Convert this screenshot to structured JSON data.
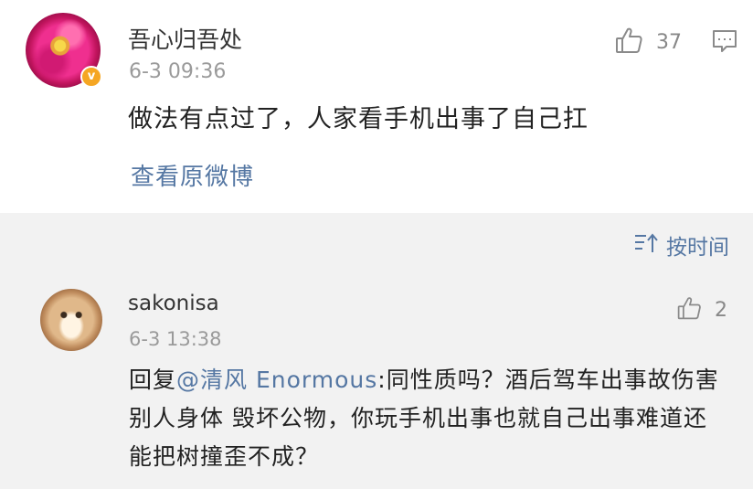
{
  "main_comment": {
    "username": "吾心归吾处",
    "timestamp": "6-3 09:36",
    "text": "做法有点过了，人家看手机出事了自己扛",
    "like_count": "37",
    "view_original_label": "查看原微博",
    "verified_badge": "v"
  },
  "sort": {
    "label": "按时间"
  },
  "reply": {
    "username": "sakonisa",
    "timestamp": "6-3 13:38",
    "like_count": "2",
    "prefix": "回复",
    "mention": "@清风 Enormous",
    "body": ":同性质吗？酒后驾车出事故伤害别人身体 毁坏公物，你玩手机出事也就自己出事难道还能把树撞歪不成？"
  },
  "colors": {
    "link": "#5577a3",
    "verified": "#f5a623",
    "background_gray": "#f2f2f2"
  },
  "icons": [
    "thumbs-up-icon",
    "comment-icon",
    "sort-icon"
  ]
}
